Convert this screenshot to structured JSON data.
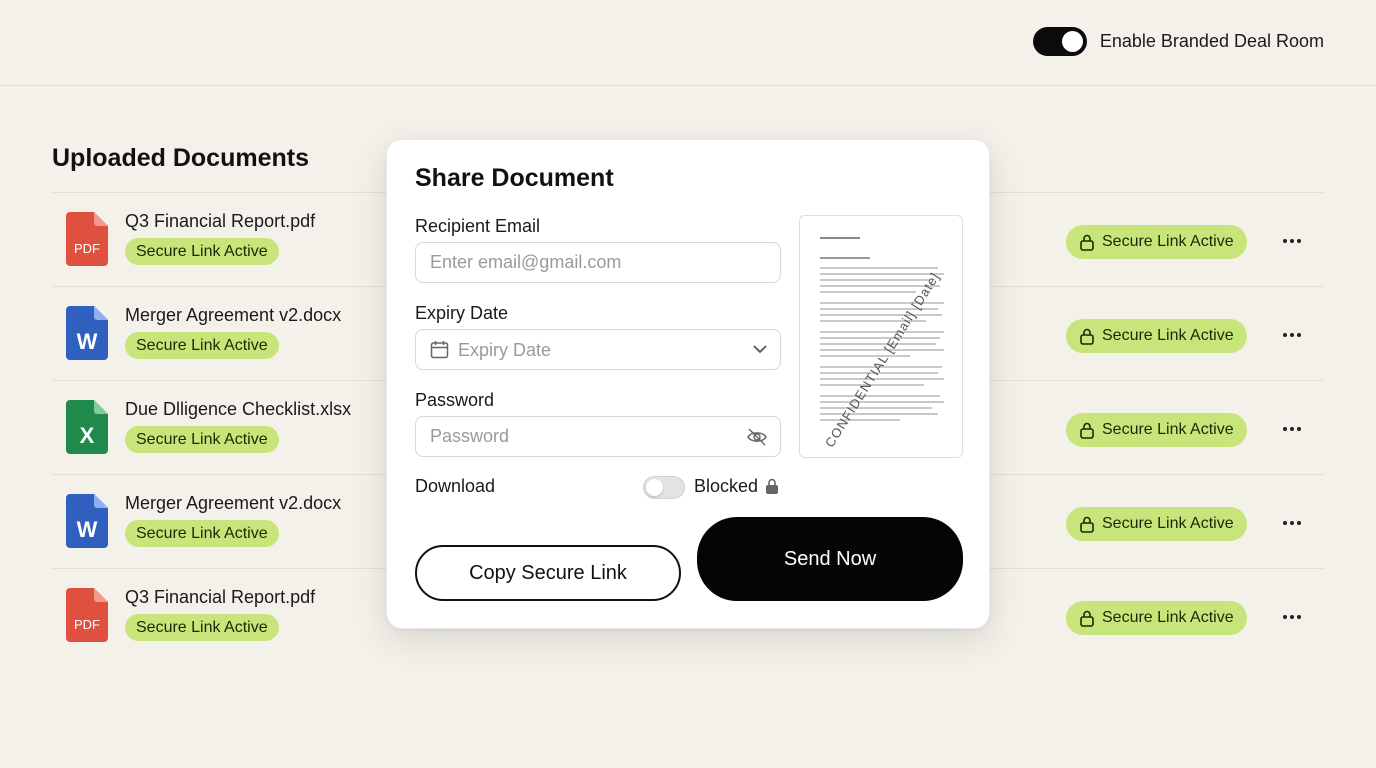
{
  "header": {
    "branded_toggle_label": "Enable Branded Deal Room",
    "branded_toggle_on": true
  },
  "documents_section": {
    "title": "Uploaded Documents",
    "rows": [
      {
        "name": "Q3 Financial Report.pdf",
        "type": "pdf",
        "type_label": "PDF",
        "status": "Secure Link Active",
        "lock_status": "Secure Link Active"
      },
      {
        "name": "Merger Agreement v2.docx",
        "type": "word",
        "type_label": "W",
        "status": "Secure Link Active",
        "lock_status": "Secure Link Active"
      },
      {
        "name": "Due Dlligence Checklist.xlsx",
        "type": "excel",
        "type_label": "X",
        "status": "Secure Link Active",
        "lock_status": "Secure Link Active"
      },
      {
        "name": "Merger Agreement v2.docx",
        "type": "word",
        "type_label": "W",
        "status": "Secure Link Active",
        "lock_status": "Secure Link Active"
      },
      {
        "name": "Q3 Financial Report.pdf",
        "type": "pdf",
        "type_label": "PDF",
        "status": "Secure Link Active",
        "lock_status": "Secure Link Active"
      }
    ]
  },
  "share_modal": {
    "title": "Share Document",
    "recipient_label": "Recipient Email",
    "recipient_placeholder": "Enter email@gmail.com",
    "expiry_label": "Expiry Date",
    "expiry_placeholder": "Expiry Date",
    "password_label": "Password",
    "password_placeholder": "Password",
    "download_label": "Download",
    "download_state": "Blocked",
    "download_enabled": false,
    "preview_watermark": "CONFIDENTIAL [Email] [Date]",
    "copy_button": "Copy Secure Link",
    "send_button": "Send Now"
  },
  "colors": {
    "background": "#f4f1ea",
    "badge_green": "#c7e57a",
    "pdf_red": "#e0503f",
    "word_blue": "#2f5fbf",
    "excel_green": "#1f8a4c",
    "primary_black": "#050505"
  },
  "icons": {
    "lock": "lock-icon",
    "more": "more-horizontal-icon",
    "calendar": "calendar-icon",
    "chevron": "chevron-down-icon",
    "eye_off": "eye-off-icon"
  }
}
